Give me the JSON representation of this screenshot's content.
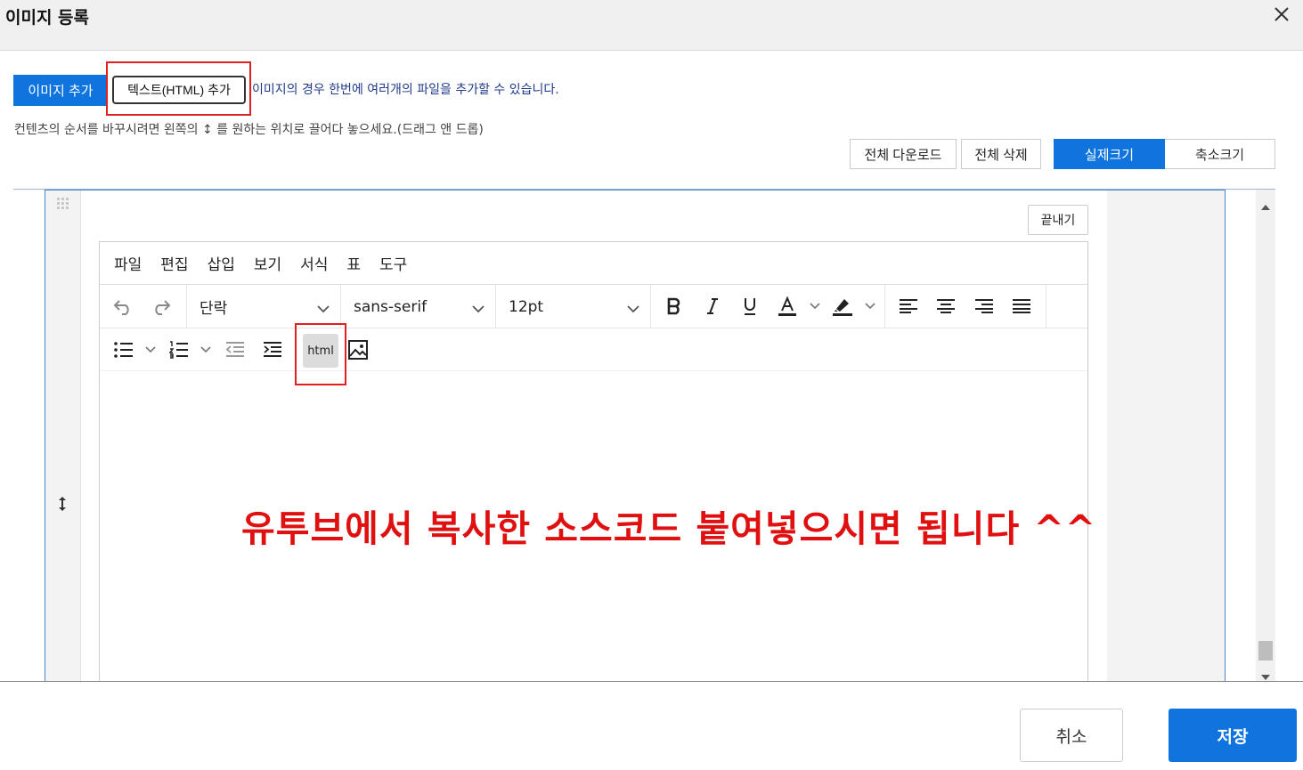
{
  "modal": {
    "title": "이미지 등록"
  },
  "actions": {
    "add_image": "이미지 추가",
    "add_text": "텍스트(HTML) 추가",
    "multi_file_hint": "이미지의 경우 한번에 여러개의 파일을 추가할 수 있습니다.",
    "order_hint": "컨텐츠의 순서를 바꾸시려면 왼쪽의 ↕ 를 원하는 위치로 끌어다 놓으세요.(드래그 앤 드롭)"
  },
  "view_controls": {
    "download_all": "전체 다운로드",
    "delete_all": "전체 삭제",
    "actual_size": "실제크기",
    "reduced_size": "축소크기"
  },
  "item": {
    "finish_label": "끝내기"
  },
  "editor": {
    "menus": [
      "파일",
      "편집",
      "삽입",
      "보기",
      "서식",
      "표",
      "도구"
    ],
    "block_format": "단락",
    "font_family": "sans-serif",
    "font_size": "12pt",
    "html_button_label": "html",
    "icons": [
      "undo-icon",
      "redo-icon",
      "bold-icon",
      "italic-icon",
      "underline-icon",
      "text-color-icon",
      "highlight-icon",
      "align-left-icon",
      "align-center-icon",
      "align-right-icon",
      "justify-icon",
      "bullet-list-icon",
      "numbered-list-icon",
      "outdent-icon",
      "indent-icon",
      "image-icon"
    ]
  },
  "annotation": {
    "text": "유투브에서 복사한 소스코드 붙여넣으시면 됩니다 ^^",
    "color": "#e01010"
  },
  "footer": {
    "cancel": "취소",
    "save": "저장"
  },
  "colors": {
    "primary": "#0f74de",
    "highlight_border": "#e02020"
  }
}
